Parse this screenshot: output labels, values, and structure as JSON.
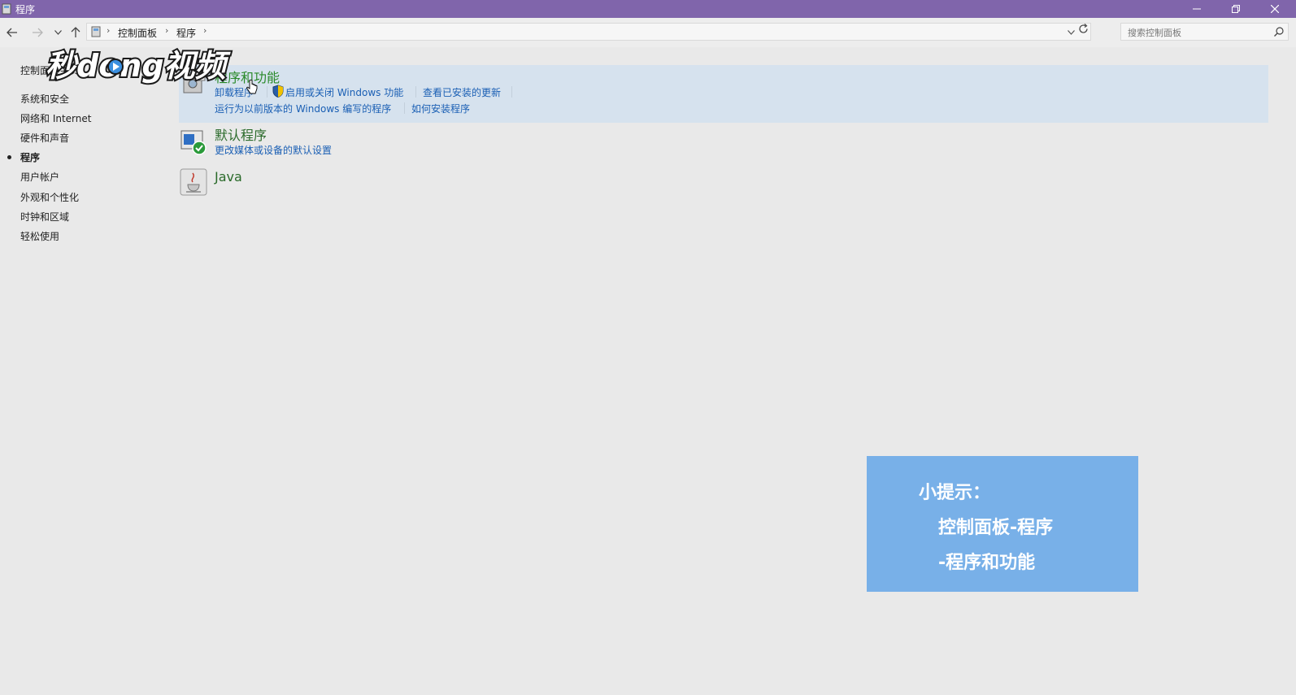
{
  "window": {
    "title": "程序"
  },
  "address_bar": {
    "crumbs": [
      "控制面板",
      "程序"
    ]
  },
  "search": {
    "placeholder": "搜索控制面板"
  },
  "sidebar": {
    "home_label": "控制面板主页",
    "items": [
      {
        "label": "系统和安全",
        "current": false
      },
      {
        "label": "网络和 Internet",
        "current": false
      },
      {
        "label": "硬件和声音",
        "current": false
      },
      {
        "label": "程序",
        "current": true
      },
      {
        "label": "用户帐户",
        "current": false
      },
      {
        "label": "外观和个性化",
        "current": false
      },
      {
        "label": "时钟和区域",
        "current": false
      },
      {
        "label": "轻松使用",
        "current": false
      }
    ]
  },
  "categories": {
    "programs_features": {
      "title": "程序和功能",
      "links": [
        "卸载程序",
        "启用或关闭 Windows 功能",
        "查看已安装的更新",
        "运行为以前版本的 Windows 编写的程序",
        "如何安装程序"
      ]
    },
    "default_programs": {
      "title": "默认程序",
      "links": [
        "更改媒体或设备的默认设置"
      ]
    },
    "java": {
      "title": "Java"
    }
  },
  "watermark": {
    "text": "秒dong视频"
  },
  "tip": {
    "line1": "小提示：",
    "line2": "控制面板-程序",
    "line3": "-程序和功能"
  },
  "colors": {
    "titlebar": "#8065ab",
    "tip_bg": "#78b0e8",
    "link": "#1a5fb4",
    "category_title": "#2a8a2a",
    "highlight": "#d6e2ee"
  }
}
